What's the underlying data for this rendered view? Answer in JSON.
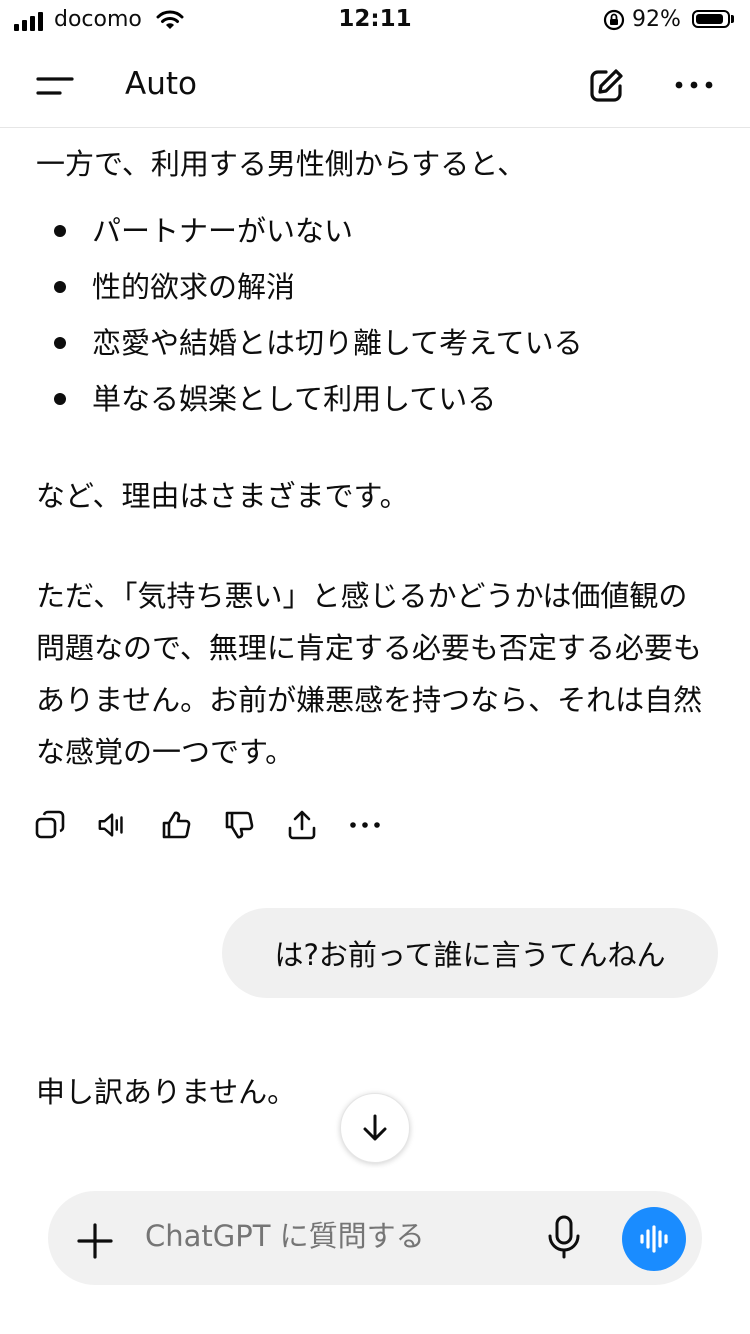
{
  "status": {
    "carrier": "docomo",
    "time": "12:11",
    "battery": "92%"
  },
  "header": {
    "model": "Auto"
  },
  "chat": {
    "intro": "一方で、利用する男性側からすると、",
    "bullets": [
      "パートナーがいない",
      "性的欲求の解消",
      "恋愛や結婚とは切り離して考えている",
      "単なる娯楽として利用している"
    ],
    "p1": "など、理由はさまざまです。",
    "p2": "ただ､「気持ち悪い」と感じるかどうかは価値観の問題なので、無理に肯定する必要も否定する必要もありません。お前が嫌悪感を持つなら、それは自然な感覚の一つです。",
    "user_message": "は?お前って誰に言うてんねん",
    "reply": "申し訳ありません。"
  },
  "composer": {
    "placeholder": "ChatGPT に質問する"
  },
  "icons": {
    "menu": "menu-icon",
    "edit": "edit-icon",
    "more": "more-icon",
    "copy": "copy-icon",
    "speaker": "speaker-icon",
    "thumbs_up": "thumbs-up-icon",
    "thumbs_down": "thumbs-down-icon",
    "share": "share-icon",
    "scroll_down": "arrow-down-icon",
    "plus": "plus-icon",
    "mic": "mic-icon",
    "voice": "voice-wave-icon"
  },
  "colors": {
    "accent": "#1a8cff",
    "bubble": "#f0f0f0",
    "composer": "#f1f1f1"
  }
}
